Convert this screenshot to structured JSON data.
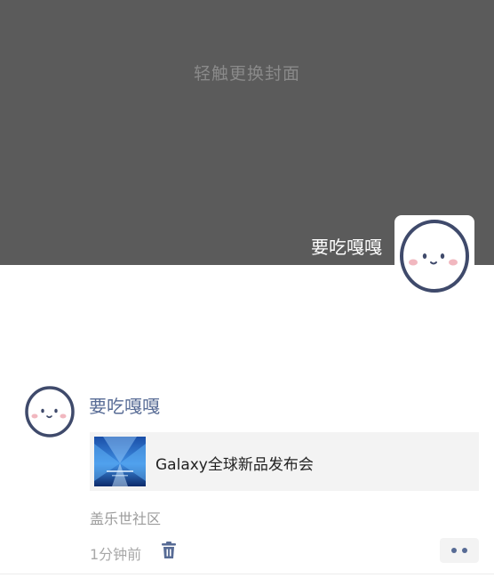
{
  "cover": {
    "hint": "轻触更换封面",
    "username": "要吃嘎嘎"
  },
  "post": {
    "author": "要吃嘎嘎",
    "link_title": "Galaxy全球新品发布会",
    "location": "盖乐世社区",
    "time": "1分钟前"
  },
  "icons": {
    "avatar": "cute-face-icon",
    "delete": "trash-icon",
    "more": "more-dots-icon"
  },
  "colors": {
    "cover_bg": "#5b5b5b",
    "name_link": "#576b95",
    "card_bg": "#f3f3f3",
    "meta_text": "#9b9b9b"
  }
}
